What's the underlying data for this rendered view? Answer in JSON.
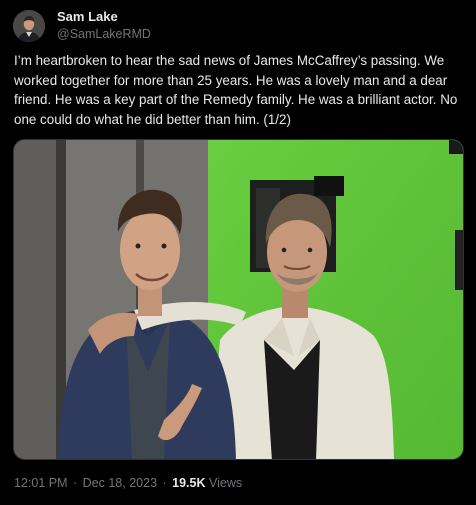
{
  "author": {
    "display_name": "Sam Lake",
    "handle": "@SamLakeRMD",
    "avatar_icon": "profile-photo"
  },
  "tweet": {
    "text": "I’m heartbroken to hear the sad news of James McCaffrey’s passing. We worked together for more than 25 years. He was a lovely man and a dear friend. He was a key part of the Remedy family. He was a brilliant actor. No one could do what he did better than him. (1/2)",
    "media": {
      "type": "photo",
      "description_icon": "photo-two-men-posing"
    }
  },
  "meta": {
    "time": "12:01 PM",
    "separator": "·",
    "date": "Dec 18, 2023",
    "views_count": "19.5K",
    "views_label": "Views"
  },
  "colors": {
    "background": "#000000",
    "text_primary": "#e7e9ea",
    "text_secondary": "#71767b",
    "green_screen": "#62c93a"
  }
}
